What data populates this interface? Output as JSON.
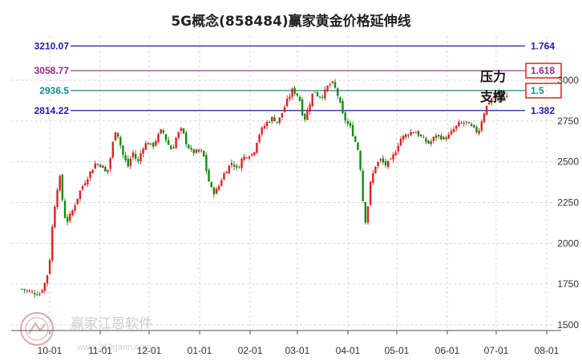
{
  "chart_data": {
    "type": "candlestick",
    "title": "5G概念(858484)赢家黄金价格延伸线",
    "y_ticks": [
      3000,
      2750,
      2500,
      2250,
      2000,
      1750,
      1500
    ],
    "ylim": [
      1500,
      3250
    ],
    "x_ticks": [
      "10-01",
      "11-01",
      "12-01",
      "01-01",
      "02-01",
      "03-01",
      "04-01",
      "05-01",
      "06-01",
      "07-01",
      "08-01"
    ],
    "levels": [
      {
        "price": "3210.07",
        "ratio": "1.764",
        "value": 3210.07,
        "color": "#1e1ea0"
      },
      {
        "price": "3058.77",
        "ratio": "1.618",
        "value": 3058.77,
        "color": "#8b2a8b",
        "boxed": true
      },
      {
        "price": "2936.5",
        "ratio": "1.5",
        "value": 2936.5,
        "color": "#1b8a8a",
        "boxed": true
      },
      {
        "price": "2814.22",
        "ratio": "1.382",
        "value": 2814.22,
        "color": "#1e1ea0"
      }
    ],
    "annotations": {
      "resistance": "压力",
      "support": "支撑"
    },
    "colors": {
      "up": "#e02020",
      "down": "#138a13",
      "box": "#e02020"
    },
    "close_path": [
      [
        "09-14",
        1720
      ],
      [
        "09-20",
        1700
      ],
      [
        "09-25",
        1690
      ],
      [
        "09-27",
        1735
      ],
      [
        "09-29",
        1780
      ],
      [
        "10-01",
        1900
      ],
      [
        "10-03",
        2150
      ],
      [
        "10-05",
        2300
      ],
      [
        "10-07",
        2420
      ],
      [
        "10-09",
        2250
      ],
      [
        "10-11",
        2120
      ],
      [
        "10-15",
        2200
      ],
      [
        "10-20",
        2330
      ],
      [
        "10-25",
        2420
      ],
      [
        "10-29",
        2490
      ],
      [
        "11-02",
        2480
      ],
      [
        "11-05",
        2420
      ],
      [
        "11-08",
        2560
      ],
      [
        "11-10",
        2700
      ],
      [
        "11-12",
        2660
      ],
      [
        "11-15",
        2540
      ],
      [
        "11-18",
        2470
      ],
      [
        "11-21",
        2560
      ],
      [
        "11-24",
        2490
      ],
      [
        "11-27",
        2590
      ],
      [
        "11-30",
        2620
      ],
      [
        "12-03",
        2590
      ],
      [
        "12-06",
        2650
      ],
      [
        "12-09",
        2700
      ],
      [
        "12-12",
        2620
      ],
      [
        "12-15",
        2570
      ],
      [
        "12-18",
        2660
      ],
      [
        "12-21",
        2700
      ],
      [
        "12-24",
        2610
      ],
      [
        "12-27",
        2560
      ],
      [
        "12-30",
        2560
      ],
      [
        "01-03",
        2560
      ],
      [
        "01-06",
        2400
      ],
      [
        "01-09",
        2310
      ],
      [
        "01-12",
        2330
      ],
      [
        "01-15",
        2410
      ],
      [
        "01-18",
        2460
      ],
      [
        "01-21",
        2500
      ],
      [
        "01-24",
        2450
      ],
      [
        "01-27",
        2520
      ],
      [
        "01-30",
        2540
      ],
      [
        "02-03",
        2550
      ],
      [
        "02-06",
        2660
      ],
      [
        "02-09",
        2710
      ],
      [
        "02-12",
        2750
      ],
      [
        "02-15",
        2770
      ],
      [
        "02-18",
        2740
      ],
      [
        "02-21",
        2810
      ],
      [
        "02-24",
        2880
      ],
      [
        "02-27",
        2940
      ],
      [
        "03-02",
        2900
      ],
      [
        "03-05",
        2750
      ],
      [
        "03-08",
        2840
      ],
      [
        "03-11",
        2940
      ],
      [
        "03-14",
        2900
      ],
      [
        "03-17",
        2910
      ],
      [
        "03-20",
        2970
      ],
      [
        "03-23",
        2980
      ],
      [
        "03-26",
        2900
      ],
      [
        "03-29",
        2780
      ],
      [
        "04-01",
        2730
      ],
      [
        "04-03",
        2700
      ],
      [
        "04-05",
        2640
      ],
      [
        "04-08",
        2550
      ],
      [
        "04-10",
        2280
      ],
      [
        "04-12",
        2120
      ],
      [
        "04-15",
        2380
      ],
      [
        "04-18",
        2480
      ],
      [
        "04-21",
        2510
      ],
      [
        "04-24",
        2480
      ],
      [
        "04-27",
        2500
      ],
      [
        "04-30",
        2560
      ],
      [
        "05-03",
        2640
      ],
      [
        "05-06",
        2660
      ],
      [
        "05-09",
        2680
      ],
      [
        "05-12",
        2690
      ],
      [
        "05-15",
        2660
      ],
      [
        "05-18",
        2630
      ],
      [
        "05-21",
        2610
      ],
      [
        "05-24",
        2650
      ],
      [
        "05-27",
        2660
      ],
      [
        "05-30",
        2640
      ],
      [
        "06-02",
        2660
      ],
      [
        "06-05",
        2700
      ],
      [
        "06-08",
        2730
      ],
      [
        "06-11",
        2740
      ],
      [
        "06-14",
        2730
      ],
      [
        "06-17",
        2700
      ],
      [
        "06-20",
        2680
      ],
      [
        "06-23",
        2790
      ],
      [
        "06-26",
        2860
      ],
      [
        "06-29",
        2900
      ],
      [
        "07-02",
        2920
      ],
      [
        "07-05",
        2890
      ],
      [
        "07-08",
        2905
      ]
    ]
  },
  "watermark": {
    "text": "赢家江恩软件",
    "url": "www.360gann.com"
  }
}
